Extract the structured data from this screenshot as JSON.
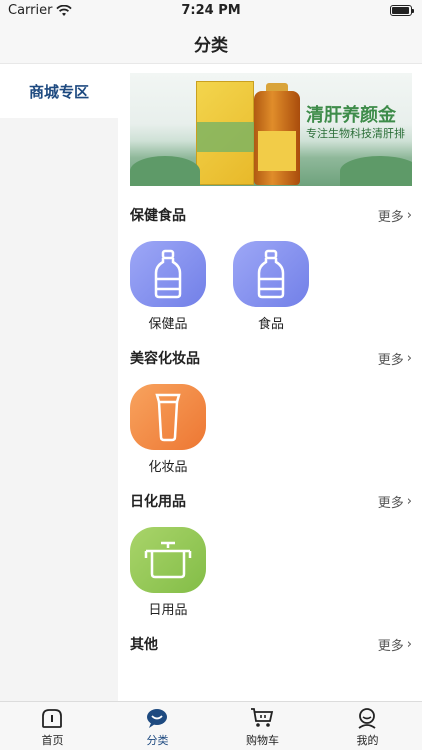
{
  "status_bar": {
    "carrier": "Carrier",
    "time": "7:24 PM"
  },
  "nav": {
    "title": "分类"
  },
  "sidebar": {
    "items": [
      {
        "label": "商城专区",
        "selected": true
      }
    ]
  },
  "banner": {
    "headline": "清肝养颜金",
    "subline": "专注生物科技清肝排"
  },
  "sections": [
    {
      "title": "保健食品",
      "more": "更多",
      "items": [
        {
          "label": "保健品",
          "icon": "bottle-icon"
        },
        {
          "label": "食品",
          "icon": "bottle-icon"
        }
      ]
    },
    {
      "title": "美容化妆品",
      "more": "更多",
      "items": [
        {
          "label": "化妆品",
          "icon": "cosmetic-tube-icon"
        }
      ]
    },
    {
      "title": "日化用品",
      "more": "更多",
      "items": [
        {
          "label": "日用品",
          "icon": "pot-icon"
        }
      ]
    },
    {
      "title": "其他",
      "more": "更多",
      "items": []
    }
  ],
  "tab_bar": {
    "tabs": [
      {
        "label": "首页",
        "icon": "home-icon",
        "active": false
      },
      {
        "label": "分类",
        "icon": "category-chat-icon",
        "active": true
      },
      {
        "label": "购物车",
        "icon": "cart-icon",
        "active": false
      },
      {
        "label": "我的",
        "icon": "user-icon",
        "active": false
      }
    ]
  },
  "colors": {
    "accent": "#1e4a80",
    "tile_blue": "#7f8cec",
    "tile_orange": "#f08a42",
    "tile_green": "#95c757"
  }
}
